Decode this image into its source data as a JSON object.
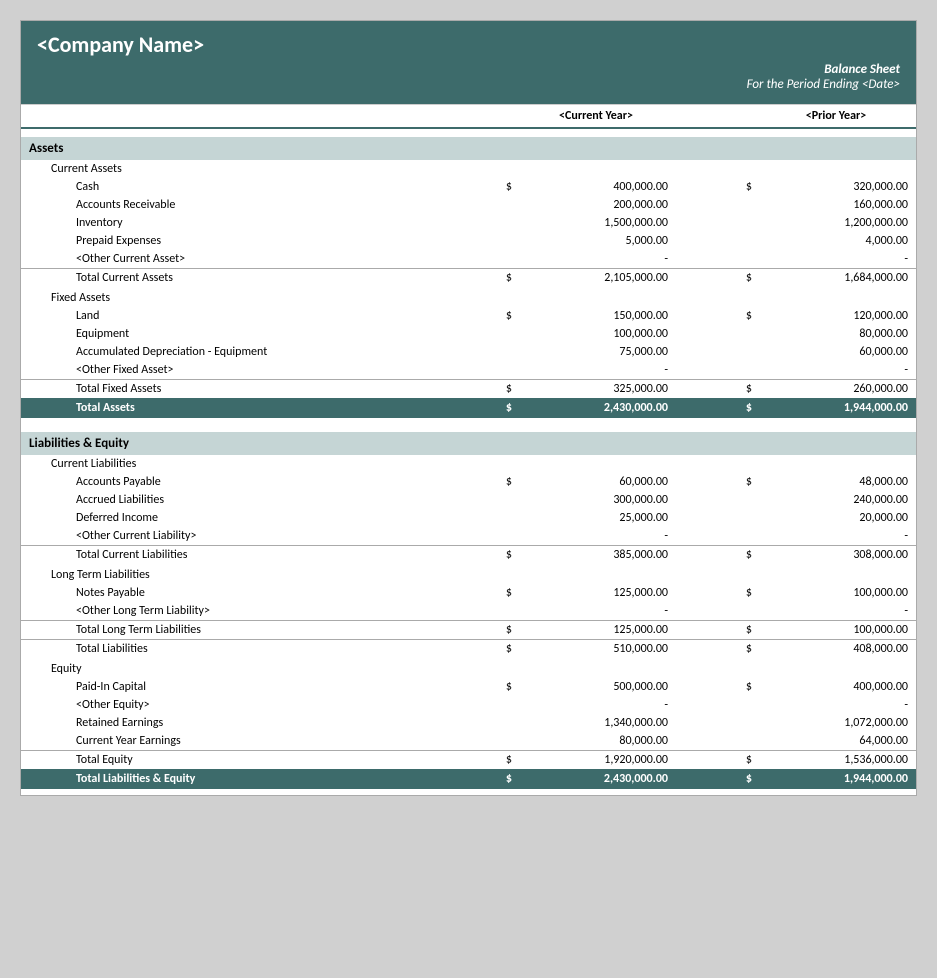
{
  "header": {
    "company_name": "<Company Name>",
    "doc_title": "Balance Sheet",
    "doc_subtitle": "For the Period Ending <Date>"
  },
  "columns": {
    "current_year_label": "<Current Year>",
    "prior_year_label": "<Prior Year>"
  },
  "assets": {
    "section_label": "Assets",
    "current_assets": {
      "label": "Current Assets",
      "items": [
        {
          "name": "Cash",
          "cy_dollar": "$",
          "cy_value": "400,000.00",
          "py_dollar": "$",
          "py_value": "320,000.00"
        },
        {
          "name": "Accounts Receivable",
          "cy_dollar": "",
          "cy_value": "200,000.00",
          "py_dollar": "",
          "py_value": "160,000.00"
        },
        {
          "name": "Inventory",
          "cy_dollar": "",
          "cy_value": "1,500,000.00",
          "py_dollar": "",
          "py_value": "1,200,000.00"
        },
        {
          "name": "Prepaid Expenses",
          "cy_dollar": "",
          "cy_value": "5,000.00",
          "py_dollar": "",
          "py_value": "4,000.00"
        },
        {
          "name": "<Other Current Asset>",
          "cy_dollar": "",
          "cy_value": "-",
          "py_dollar": "",
          "py_value": "-"
        }
      ],
      "total_label": "Total Current Assets",
      "total_cy_dollar": "$",
      "total_cy_value": "2,105,000.00",
      "total_py_dollar": "$",
      "total_py_value": "1,684,000.00"
    },
    "fixed_assets": {
      "label": "Fixed Assets",
      "items": [
        {
          "name": "Land",
          "cy_dollar": "$",
          "cy_value": "150,000.00",
          "py_dollar": "$",
          "py_value": "120,000.00"
        },
        {
          "name": "Equipment",
          "cy_dollar": "",
          "cy_value": "100,000.00",
          "py_dollar": "",
          "py_value": "80,000.00"
        },
        {
          "name": "Accumulated Depreciation - Equipment",
          "cy_dollar": "",
          "cy_value": "75,000.00",
          "py_dollar": "",
          "py_value": "60,000.00"
        },
        {
          "name": "<Other Fixed Asset>",
          "cy_dollar": "",
          "cy_value": "-",
          "py_dollar": "",
          "py_value": "-"
        }
      ],
      "total_label": "Total Fixed Assets",
      "total_cy_dollar": "$",
      "total_cy_value": "325,000.00",
      "total_py_dollar": "$",
      "total_py_value": "260,000.00"
    },
    "total_label": "Total Assets",
    "total_cy_dollar": "$",
    "total_cy_value": "2,430,000.00",
    "total_py_dollar": "$",
    "total_py_value": "1,944,000.00"
  },
  "liabilities_equity": {
    "section_label": "Liabilities & Equity",
    "current_liabilities": {
      "label": "Current Liabilities",
      "items": [
        {
          "name": "Accounts Payable",
          "cy_dollar": "$",
          "cy_value": "60,000.00",
          "py_dollar": "$",
          "py_value": "48,000.00"
        },
        {
          "name": "Accrued Liabilities",
          "cy_dollar": "",
          "cy_value": "300,000.00",
          "py_dollar": "",
          "py_value": "240,000.00"
        },
        {
          "name": "Deferred Income",
          "cy_dollar": "",
          "cy_value": "25,000.00",
          "py_dollar": "",
          "py_value": "20,000.00"
        },
        {
          "name": "<Other Current Liability>",
          "cy_dollar": "",
          "cy_value": "-",
          "py_dollar": "",
          "py_value": "-"
        }
      ],
      "total_label": "Total Current Liabilities",
      "total_cy_dollar": "$",
      "total_cy_value": "385,000.00",
      "total_py_dollar": "$",
      "total_py_value": "308,000.00"
    },
    "long_term_liabilities": {
      "label": "Long Term Liabilities",
      "items": [
        {
          "name": "Notes Payable",
          "cy_dollar": "$",
          "cy_value": "125,000.00",
          "py_dollar": "$",
          "py_value": "100,000.00"
        },
        {
          "name": "<Other Long Term Liability>",
          "cy_dollar": "",
          "cy_value": "-",
          "py_dollar": "",
          "py_value": "-"
        }
      ],
      "total_label": "Total Long Term Liabilities",
      "total_cy_dollar": "$",
      "total_cy_value": "125,000.00",
      "total_py_dollar": "$",
      "total_py_value": "100,000.00"
    },
    "total_liabilities_label": "Total Liabilities",
    "total_liabilities_cy_dollar": "$",
    "total_liabilities_cy_value": "510,000.00",
    "total_liabilities_py_dollar": "$",
    "total_liabilities_py_value": "408,000.00",
    "equity": {
      "label": "Equity",
      "items": [
        {
          "name": "Paid-In Capital",
          "cy_dollar": "$",
          "cy_value": "500,000.00",
          "py_dollar": "$",
          "py_value": "400,000.00"
        },
        {
          "name": "<Other Equity>",
          "cy_dollar": "",
          "cy_value": "-",
          "py_dollar": "",
          "py_value": "-"
        },
        {
          "name": "Retained Earnings",
          "cy_dollar": "",
          "cy_value": "1,340,000.00",
          "py_dollar": "",
          "py_value": "1,072,000.00"
        },
        {
          "name": "Current Year Earnings",
          "cy_dollar": "",
          "cy_value": "80,000.00",
          "py_dollar": "",
          "py_value": "64,000.00"
        }
      ],
      "total_label": "Total Equity",
      "total_cy_dollar": "$",
      "total_cy_value": "1,920,000.00",
      "total_py_dollar": "$",
      "total_py_value": "1,536,000.00"
    },
    "total_label": "Total Liabilities & Equity",
    "total_cy_dollar": "$",
    "total_cy_value": "2,430,000.00",
    "total_py_dollar": "$",
    "total_py_value": "1,944,000.00"
  }
}
